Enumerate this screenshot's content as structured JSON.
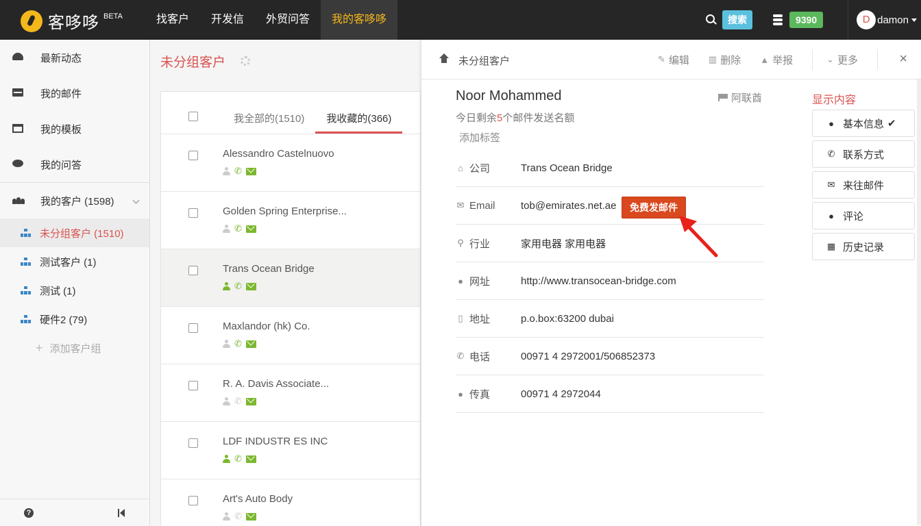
{
  "topbar": {
    "logo_text": "客哆哆",
    "logo_beta": "BETA",
    "nav": [
      "找客户",
      "开发信",
      "外贸问答",
      "我的客哆哆"
    ],
    "search_label": "搜索",
    "credits": "9390",
    "avatar_letter": "D",
    "username": "damon"
  },
  "sidebar": {
    "items": [
      "最新动态",
      "我的邮件",
      "我的模板",
      "我的问答"
    ],
    "group_head": "我的客户 (1598)",
    "groups": [
      "未分组客户 (1510)",
      "测试客户 (1)",
      "测试 (1)",
      "硬件2 (79)"
    ],
    "add_group": "添加客户组"
  },
  "list": {
    "title": "未分组客户",
    "tabs": [
      "我全部的(1510)",
      "我收藏的(366)"
    ],
    "rows": [
      {
        "name": "Alessandro Castelnuovo",
        "person": "gray",
        "phone": "green",
        "mail": "green"
      },
      {
        "name": "Golden Spring Enterprise...",
        "person": "gray",
        "phone": "green",
        "mail": "green"
      },
      {
        "name": "Trans Ocean Bridge",
        "person": "green",
        "phone": "green",
        "mail": "green"
      },
      {
        "name": "Maxlandor (hk) Co.",
        "person": "gray",
        "phone": "green",
        "mail": "green"
      },
      {
        "name": "R. A. Davis Associate...",
        "person": "gray",
        "phone": "gray",
        "mail": "green"
      },
      {
        "name": "LDF INDUSTR ES INC",
        "person": "green",
        "phone": "green",
        "mail": "green"
      },
      {
        "name": "Art's Auto Body",
        "person": "gray",
        "phone": "gray",
        "mail": "green"
      }
    ]
  },
  "detail": {
    "breadcrumb": "未分组客户",
    "actions": [
      "编辑",
      "删除",
      "举报",
      "更多"
    ],
    "name": "Noor Mohammed",
    "country": "阿联酋",
    "quota_prefix": "今日剩余",
    "quota_num": "5",
    "quota_suffix": "个邮件发送名额",
    "add_tag": "添加标签",
    "send_button": "免费发邮件",
    "fields": [
      {
        "label": "公司",
        "value": "Trans Ocean Bridge"
      },
      {
        "label": "Email",
        "value": "tob@emirates.net.ae"
      },
      {
        "label": "行业",
        "value": "家用电器 家用电器"
      },
      {
        "label": "网址",
        "value": "http://www.transocean-bridge.com"
      },
      {
        "label": "地址",
        "value": "p.o.box:63200 dubai"
      },
      {
        "label": "电话",
        "value": "00971 4 2972001/506852373"
      },
      {
        "label": "传真",
        "value": "00971 4 2972044"
      }
    ],
    "panel_title": "显示内容",
    "panel": [
      "基本信息",
      "联系方式",
      "来往邮件",
      "评论",
      "历史记录"
    ]
  },
  "colors": {
    "accent": "#d9534f",
    "brand": "#f4b81c",
    "green": "#7cb82f",
    "send": "#d9481e",
    "search": "#5bc0de"
  }
}
